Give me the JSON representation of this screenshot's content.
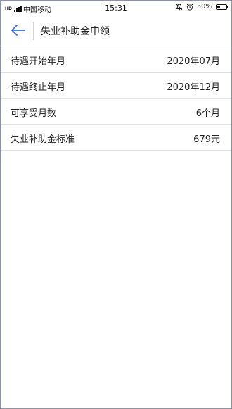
{
  "status_bar": {
    "carrier": "中国移动",
    "time": "15:31",
    "battery": "30%",
    "battery_level": 0.3,
    "icons": [
      "hd-icon",
      "signal-icon",
      "mute-icon",
      "alarm-icon",
      "battery-icon"
    ]
  },
  "header": {
    "title": "失业补助金申领",
    "back_icon": "back-arrow-icon",
    "accent_color": "#3a6fd8"
  },
  "details": {
    "rows": [
      {
        "label": "待遇开始年月",
        "value": "2020年07月"
      },
      {
        "label": "待遇终止年月",
        "value": "2020年12月"
      },
      {
        "label": "可享受月数",
        "value": "6个月"
      },
      {
        "label": "失业补助金标准",
        "value": "679元"
      }
    ]
  }
}
